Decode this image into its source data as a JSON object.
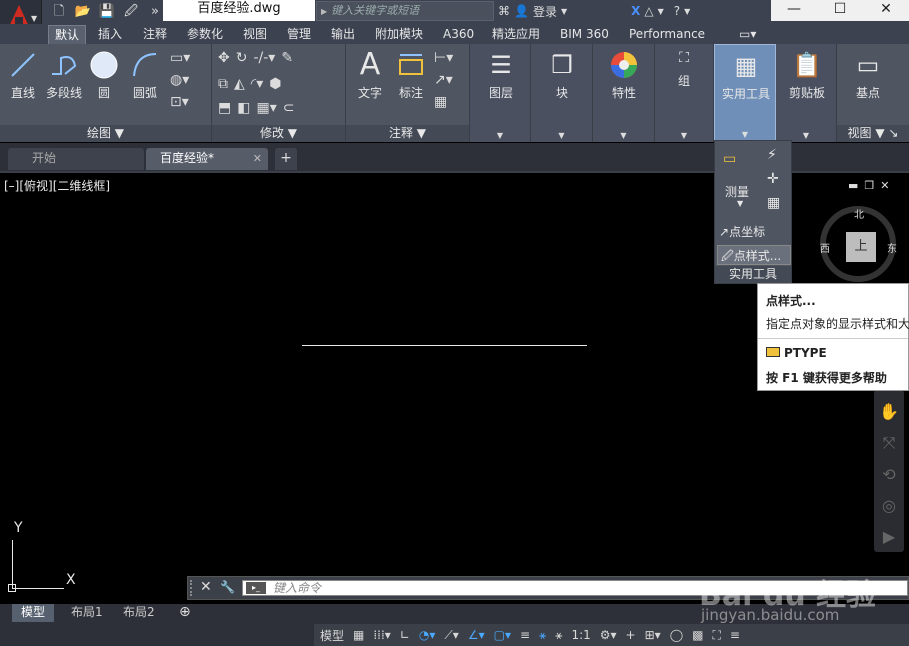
{
  "titlebar": {
    "document_title": "百度经验.dwg",
    "search_placeholder": "键入关键字或短语",
    "login_label": "登录",
    "window_minimize": "—",
    "window_maximize": "☐",
    "window_close": "✕"
  },
  "ribbon_tabs": [
    "默认",
    "插入",
    "注释",
    "参数化",
    "视图",
    "管理",
    "输出",
    "附加模块",
    "A360",
    "精选应用",
    "BIM 360",
    "Performance"
  ],
  "active_ribbon_tab": "默认",
  "ribbon": {
    "draw_panel": {
      "title": "绘图",
      "buttons": [
        "直线",
        "多段线",
        "圆",
        "圆弧"
      ]
    },
    "modify_panel": {
      "title": "修改"
    },
    "annotation_panel": {
      "title": "注释",
      "buttons": [
        "文字",
        "标注"
      ]
    },
    "layers_label": "图层",
    "block_label": "块",
    "properties_label": "特性",
    "group_label": "组",
    "utilities_label": "实用工具",
    "clipboard_label": "剪贴板",
    "view_panel": {
      "basepoint_label": "基点",
      "title": "视图"
    }
  },
  "file_tabs": {
    "home": "开始",
    "current": "百度经验*",
    "close": "✕",
    "new": "+"
  },
  "viewport": {
    "label": "[–][俯视][二维线框]",
    "viewcube_face": "上",
    "north": "北",
    "west": "西",
    "east": "东"
  },
  "utilities_dropdown": {
    "measure_label": "测量",
    "point_coords_label": "点坐标",
    "point_style_label": "点样式...",
    "panel_title": "实用工具"
  },
  "tooltip": {
    "title": "点样式...",
    "description": "指定点对象的显示样式和大",
    "command": "PTYPE",
    "help": "按 F1 键获得更多帮助"
  },
  "ucs": {
    "x_label": "X",
    "y_label": "Y"
  },
  "command_line": {
    "placeholder": "键入命令"
  },
  "layout_tabs": [
    "模型",
    "布局1",
    "布局2"
  ],
  "active_layout_tab": "模型",
  "status": {
    "model_label": "模型",
    "scale_label": "1:1"
  },
  "watermark": {
    "logo": "Bai du 经验",
    "site": "jingyan.baidu.com"
  }
}
